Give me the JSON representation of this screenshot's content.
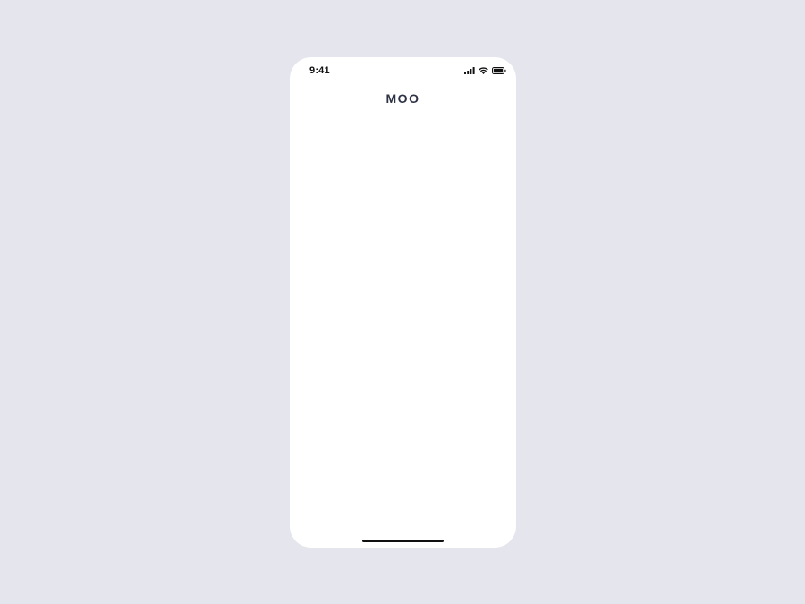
{
  "status_bar": {
    "time": "9:41",
    "icons": [
      "cellular-signal-icon",
      "wifi-icon",
      "battery-icon"
    ]
  },
  "app": {
    "title": "MOO"
  },
  "colors": {
    "background": "#e5e5ee",
    "screen": "#ffffff",
    "title": "#2e3344"
  }
}
